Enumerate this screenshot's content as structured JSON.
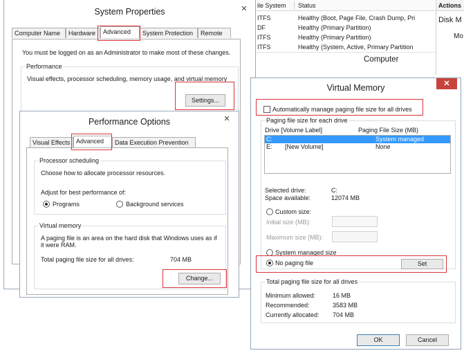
{
  "disk_table": {
    "headers": [
      "ile System",
      "Status"
    ],
    "rows": [
      {
        "fs": "ITFS",
        "status": "Healthy (Boot, Page File, Crash Dump, Pri"
      },
      {
        "fs": "DF",
        "status": "Healthy (Primary Partition)"
      },
      {
        "fs": "ITFS",
        "status": "Healthy (Primary Partition)"
      },
      {
        "fs": "ITFS",
        "status": "Healthy (System, Active, Primary Partition"
      }
    ],
    "actions_header": "Actions",
    "actions_item": "Disk M",
    "actions_more": "Mo",
    "computer_label": "Computer"
  },
  "system_properties": {
    "title": "System Properties",
    "close": "✕",
    "tabs": [
      "Computer Name",
      "Hardware",
      "Advanced",
      "System Protection",
      "Remote"
    ],
    "admin_note": "You must be logged on as an Administrator to make most of these changes.",
    "performance": {
      "label": "Performance",
      "desc": "Visual effects, processor scheduling, memory usage, and virtual memory",
      "settings_button": "Settings..."
    }
  },
  "performance_options": {
    "title": "Performance Options",
    "close": "✕",
    "tabs": [
      "Visual Effects",
      "Advanced",
      "Data Execution Prevention"
    ],
    "processor": {
      "label": "Processor scheduling",
      "desc": "Choose how to allocate processor resources.",
      "adjust": "Adjust for best performance of:",
      "opt_programs": "Programs",
      "opt_background": "Background services"
    },
    "virtual_memory": {
      "label": "Virtual memory",
      "desc": "A paging file is an area on the hard disk that Windows uses as if it were RAM.",
      "total_label": "Total paging file size for all drives:",
      "total_value": "704 MB",
      "change_button": "Change..."
    }
  },
  "virtual_memory": {
    "title": "Virtual Memory",
    "close": "✕",
    "auto_manage": "Automatically manage paging file size for all drives",
    "per_drive_label": "Paging file size for each drive",
    "col_drive": "Drive  [Volume Label]",
    "col_size": "Paging File Size (MB)",
    "drives": [
      {
        "drive": "C:",
        "label": "",
        "size": "System managed"
      },
      {
        "drive": "E:",
        "label": "[New Volume]",
        "size": "None"
      }
    ],
    "selected_drive_label": "Selected drive:",
    "selected_drive_value": "C:",
    "space_label": "Space available:",
    "space_value": "12074 MB",
    "custom_size": "Custom size:",
    "initial_size": "Initial size (MB):",
    "max_size": "Maximum size (MB):",
    "system_managed": "System managed size",
    "no_paging": "No paging file",
    "set_button": "Set",
    "totals": {
      "label": "Total paging file size for all drives",
      "min_label": "Minimum allowed:",
      "min_value": "16 MB",
      "rec_label": "Recommended:",
      "rec_value": "3583 MB",
      "cur_label": "Currently allocated:",
      "cur_value": "704 MB"
    },
    "ok_button": "OK",
    "cancel_button": "Cancel"
  },
  "colors": {
    "highlight_red": "#d9343a",
    "selection_blue": "#3399ff",
    "close_red": "#c7443c"
  }
}
